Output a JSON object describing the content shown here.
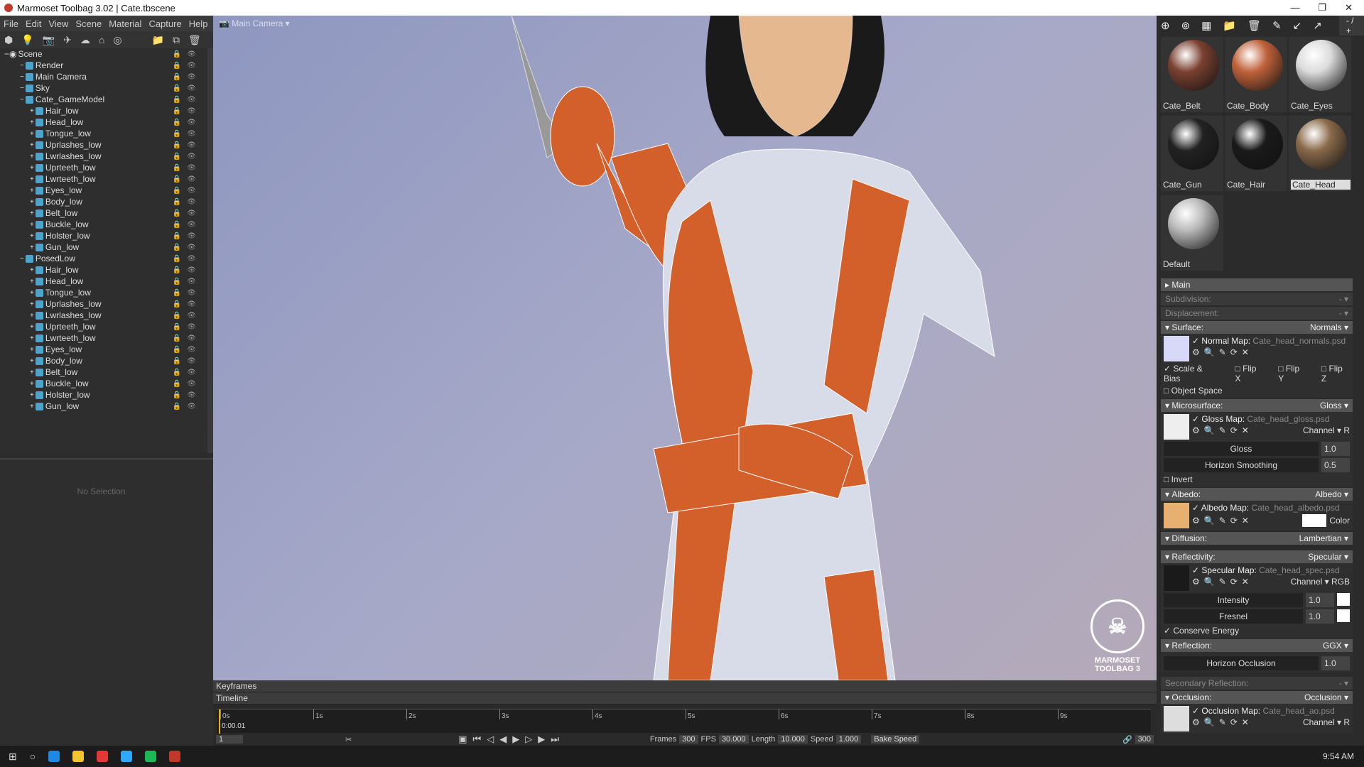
{
  "window": {
    "title": "Marmoset Toolbag 3.02  |  Cate.tbscene",
    "controls": [
      "—",
      "❐",
      "✕"
    ]
  },
  "menu": [
    "File",
    "Edit",
    "View",
    "Scene",
    "Material",
    "Capture",
    "Help"
  ],
  "scene_tree": {
    "root": "Scene",
    "items": [
      {
        "label": "Render",
        "depth": 1
      },
      {
        "label": "Main Camera",
        "depth": 1
      },
      {
        "label": "Sky",
        "depth": 1
      },
      {
        "label": "Cate_GameModel",
        "depth": 1
      },
      {
        "label": "Hair_low",
        "depth": 2
      },
      {
        "label": "Head_low",
        "depth": 2
      },
      {
        "label": "Tongue_low",
        "depth": 2
      },
      {
        "label": "Uprlashes_low",
        "depth": 2
      },
      {
        "label": "Lwrlashes_low",
        "depth": 2
      },
      {
        "label": "Uprteeth_low",
        "depth": 2
      },
      {
        "label": "Lwrteeth_low",
        "depth": 2
      },
      {
        "label": "Eyes_low",
        "depth": 2
      },
      {
        "label": "Body_low",
        "depth": 2
      },
      {
        "label": "Belt_low",
        "depth": 2
      },
      {
        "label": "Buckle_low",
        "depth": 2
      },
      {
        "label": "Holster_low",
        "depth": 2
      },
      {
        "label": "Gun_low",
        "depth": 2
      },
      {
        "label": "PosedLow",
        "depth": 1
      },
      {
        "label": "Hair_low",
        "depth": 2
      },
      {
        "label": "Head_low",
        "depth": 2
      },
      {
        "label": "Tongue_low",
        "depth": 2
      },
      {
        "label": "Uprlashes_low",
        "depth": 2
      },
      {
        "label": "Lwrlashes_low",
        "depth": 2
      },
      {
        "label": "Uprteeth_low",
        "depth": 2
      },
      {
        "label": "Lwrteeth_low",
        "depth": 2
      },
      {
        "label": "Eyes_low",
        "depth": 2
      },
      {
        "label": "Body_low",
        "depth": 2
      },
      {
        "label": "Belt_low",
        "depth": 2
      },
      {
        "label": "Buckle_low",
        "depth": 2
      },
      {
        "label": "Holster_low",
        "depth": 2
      },
      {
        "label": "Gun_low",
        "depth": 2
      }
    ]
  },
  "selection": {
    "empty_text": "No Selection"
  },
  "viewport": {
    "camera": "Main Camera",
    "logo_text": "MARMOSET TOOLBAG 3"
  },
  "materials": {
    "page": "- / +",
    "items": [
      {
        "name": "Cate_Belt",
        "color": "#7a4030"
      },
      {
        "name": "Cate_Body",
        "color": "#c0623a"
      },
      {
        "name": "Cate_Eyes",
        "color": "#dcdcdc"
      },
      {
        "name": "Cate_Gun",
        "color": "#222222"
      },
      {
        "name": "Cate_Hair",
        "color": "#1a1a1a"
      },
      {
        "name": "Cate_Head",
        "color": "#8a6a4a",
        "selected": true
      },
      {
        "name": "Default",
        "color": "#bbbbbb"
      }
    ]
  },
  "props": {
    "main": "Main",
    "subdivision": "Subdivision:",
    "displacement": "Displacement:",
    "dash": "-",
    "surface": {
      "label": "Surface:",
      "value": "Normals",
      "map": "Normal Map:",
      "file": "Cate_head_normals.psd",
      "scale_bias": "Scale & Bias",
      "flipx": "Flip X",
      "flipy": "Flip Y",
      "flipz": "Flip Z",
      "object_space": "Object Space"
    },
    "micro": {
      "label": "Microsurface:",
      "value": "Gloss",
      "map": "Gloss Map:",
      "file": "Cate_head_gloss.psd",
      "channel": "Channel ▾ R",
      "gloss": "Gloss",
      "gloss_v": "1.0",
      "hs": "Horizon Smoothing",
      "hs_v": "0.5",
      "invert": "Invert"
    },
    "albedo": {
      "label": "Albedo:",
      "value": "Albedo",
      "map": "Albedo Map:",
      "file": "Cate_head_albedo.psd",
      "color": "Color"
    },
    "diffusion": {
      "label": "Diffusion:",
      "value": "Lambertian"
    },
    "reflectivity": {
      "label": "Reflectivity:",
      "value": "Specular",
      "map": "Specular Map:",
      "file": "Cate_head_spec.psd",
      "channel": "Channel ▾ RGB",
      "intensity": "Intensity",
      "intensity_v": "1.0",
      "fresnel": "Fresnel",
      "fresnel_v": "1.0",
      "conserve": "Conserve Energy"
    },
    "reflection": {
      "label": "Reflection:",
      "value": "GGX",
      "ho": "Horizon Occlusion",
      "ho_v": "1.0"
    },
    "secondary": "Secondary Reflection:",
    "occlusion": {
      "label": "Occlusion:",
      "value": "Occlusion",
      "map": "Occlusion Map:",
      "file": "Cate_head_ao.psd",
      "channel": "Channel ▾ R"
    }
  },
  "timeline": {
    "keyframes": "Keyframes",
    "timeline": "Timeline",
    "ticks": [
      "0s",
      "1s",
      "2s",
      "3s",
      "4s",
      "5s",
      "6s",
      "7s",
      "8s",
      "9s"
    ],
    "current": "0:00.01",
    "frame": "1",
    "frames_label": "Frames",
    "frames": "300",
    "fps_label": "FPS",
    "fps": "30.000",
    "length_label": "Length",
    "length": "10.000",
    "speed_label": "Speed",
    "speed": "1.000",
    "bake_speed": "Bake Speed",
    "end": "300"
  },
  "taskbar": {
    "time": "9:54 AM"
  }
}
